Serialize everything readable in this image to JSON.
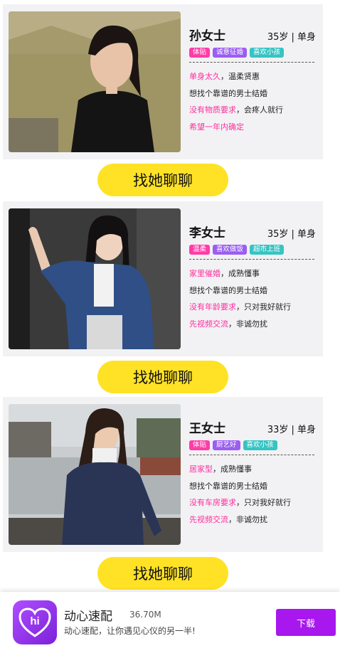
{
  "profiles": [
    {
      "name": "孙女士",
      "age_status": "35岁 | 单身",
      "tags": [
        "体贴",
        "诚意征婚",
        "喜欢小孩"
      ],
      "line1": {
        "highlight": "单身太久",
        "rest": "，温柔贤惠"
      },
      "line2": "想找个靠谱的男士结婚",
      "line3": {
        "highlight": "没有物质要求",
        "rest": "，会疼人就行"
      },
      "line4": {
        "highlight": "希望一年内确定",
        "rest": ""
      },
      "chat_label": "找她聊聊"
    },
    {
      "name": "李女士",
      "age_status": "35岁 | 单身",
      "tags": [
        "温柔",
        "喜欢做饭",
        "超市上班"
      ],
      "line1": {
        "highlight": "家里催婚",
        "rest": "，成熟懂事"
      },
      "line2": "想找个靠谱的男士结婚",
      "line3": {
        "highlight": "没有年龄要求",
        "rest": "，只对我好就行"
      },
      "line4": {
        "highlight": "先视频交流",
        "rest": "，非诚勿扰"
      },
      "chat_label": "找她聊聊"
    },
    {
      "name": "王女士",
      "age_status": "33岁 | 单身",
      "tags": [
        "体贴",
        "厨艺好",
        "喜欢小孩"
      ],
      "line1": {
        "highlight": "居家型",
        "rest": "，成熟懂事"
      },
      "line2": "想找个靠谱的男士结婚",
      "line3": {
        "highlight": "没有车房要求",
        "rest": "，只对我好就行"
      },
      "line4": {
        "highlight": "先视频交流",
        "rest": "，非诚勿扰"
      },
      "chat_label": "找她聊聊"
    }
  ],
  "banner": {
    "app_name": "动心速配",
    "app_size": "36.70M",
    "description": "动心速配，让你遇见心仪的另一半!",
    "download_label": "下载",
    "icon_text": "hi"
  },
  "colors": {
    "highlight": "#ff2d9e",
    "button_yellow": "#ffe226",
    "download_purple": "#a817ee"
  }
}
